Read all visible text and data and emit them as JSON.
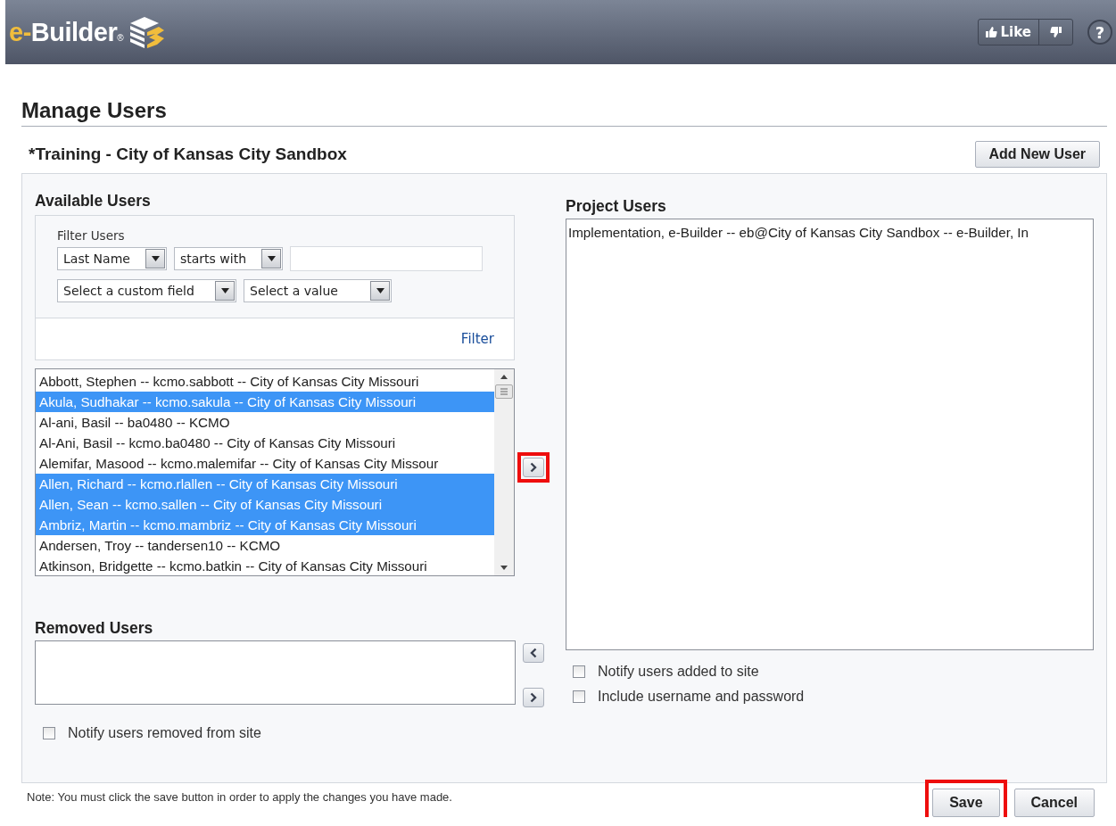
{
  "header": {
    "logo": {
      "prefix": "e-",
      "name": "Builder",
      "mark": "®"
    },
    "like_button": "Like",
    "help_button": "?"
  },
  "page_title": "Manage Users",
  "project_title": "*Training - City of Kansas City Sandbox",
  "add_user_button": "Add New User",
  "available_users": {
    "heading": "Available Users",
    "filter": {
      "label": "Filter Users",
      "field_select": "Last Name",
      "operator_select": "starts with",
      "custom_field_select": "Select a custom field",
      "value_select": "Select a value",
      "filter_link": "Filter"
    },
    "users": [
      {
        "text": "Abbott, Stephen -- kcmo.sabbott -- City of Kansas City Missouri",
        "selected": false
      },
      {
        "text": "Akula, Sudhakar -- kcmo.sakula -- City of Kansas City Missouri",
        "selected": true
      },
      {
        "text": "Al-ani, Basil -- ba0480 -- KCMO",
        "selected": false
      },
      {
        "text": "Al-Ani, Basil -- kcmo.ba0480 -- City of Kansas City Missouri",
        "selected": false
      },
      {
        "text": "Alemifar, Masood -- kcmo.malemifar -- City of Kansas City Missour",
        "selected": false
      },
      {
        "text": "Allen, Richard -- kcmo.rlallen -- City of Kansas City Missouri",
        "selected": true
      },
      {
        "text": "Allen, Sean -- kcmo.sallen -- City of Kansas City Missouri",
        "selected": true
      },
      {
        "text": "Ambriz, Martin -- kcmo.mambriz -- City of Kansas City Missouri",
        "selected": true
      },
      {
        "text": "Andersen, Troy -- tandersen10 -- KCMO",
        "selected": false
      },
      {
        "text": "Atkinson, Bridgette -- kcmo.batkin -- City of Kansas City Missouri",
        "selected": false
      }
    ]
  },
  "transfer_buttons": [
    {
      "kind": "add",
      "highlighted": true
    },
    {
      "kind": "remove",
      "highlighted": false
    },
    {
      "kind": "add",
      "highlighted": false
    }
  ],
  "removed_users": {
    "heading": "Removed Users",
    "checkboxes": [
      {
        "label": "Notify users removed from site",
        "checked": false
      }
    ]
  },
  "project_users": {
    "heading": "Project Users",
    "users": [
      {
        "text": "Implementation, e-Builder -- eb@City of Kansas City Sandbox -- e-Builder, In",
        "selected": false
      }
    ],
    "checkboxes": [
      {
        "label": "Notify users added to site",
        "checked": false
      },
      {
        "label": "Include username and password",
        "checked": false
      }
    ]
  },
  "note": "Note: You must click the save button in order to apply the changes you have made.",
  "buttons": [
    {
      "label": "Save",
      "highlighted": true
    },
    {
      "label": "Cancel",
      "highlighted": false
    }
  ]
}
